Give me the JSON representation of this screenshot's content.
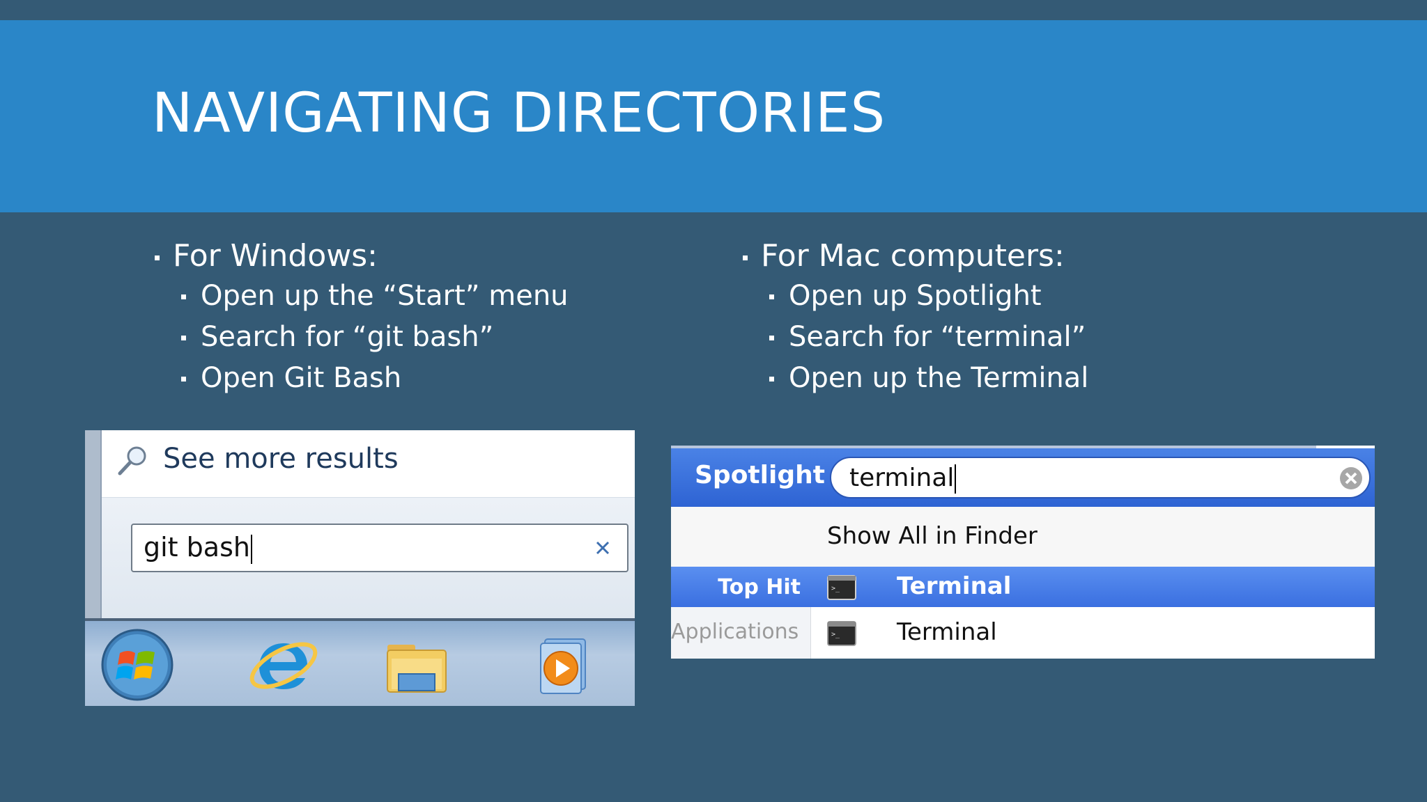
{
  "slide": {
    "title": "NAVIGATING DIRECTORIES",
    "windows": {
      "heading": "For Windows:",
      "steps": [
        "Open up the “Start” menu",
        "Search for “git bash”",
        "Open Git Bash"
      ]
    },
    "mac": {
      "heading": "For Mac computers:",
      "steps": [
        "Open up Spotlight",
        "Search for “terminal”",
        "Open up the Terminal"
      ]
    }
  },
  "windows_screenshot": {
    "see_more": "See more results",
    "search_value": "git bash",
    "icons": [
      "magnifier-icon",
      "clear-icon",
      "windows-start-orb-icon",
      "internet-explorer-icon",
      "file-explorer-icon",
      "media-player-icon"
    ]
  },
  "mac_screenshot": {
    "spotlight_label": "Spotlight",
    "search_value": "terminal",
    "show_all": "Show All in Finder",
    "top_hit_label": "Top Hit",
    "top_hit_item": "Terminal",
    "applications_label": "Applications",
    "applications_item": "Terminal",
    "icons": [
      "clear-icon",
      "terminal-app-icon"
    ]
  },
  "colors": {
    "background": "#345a75",
    "title_band": "#2a86c8",
    "spotlight_blue": "#2e63d3",
    "highlight_row": "#3a6fe0"
  }
}
